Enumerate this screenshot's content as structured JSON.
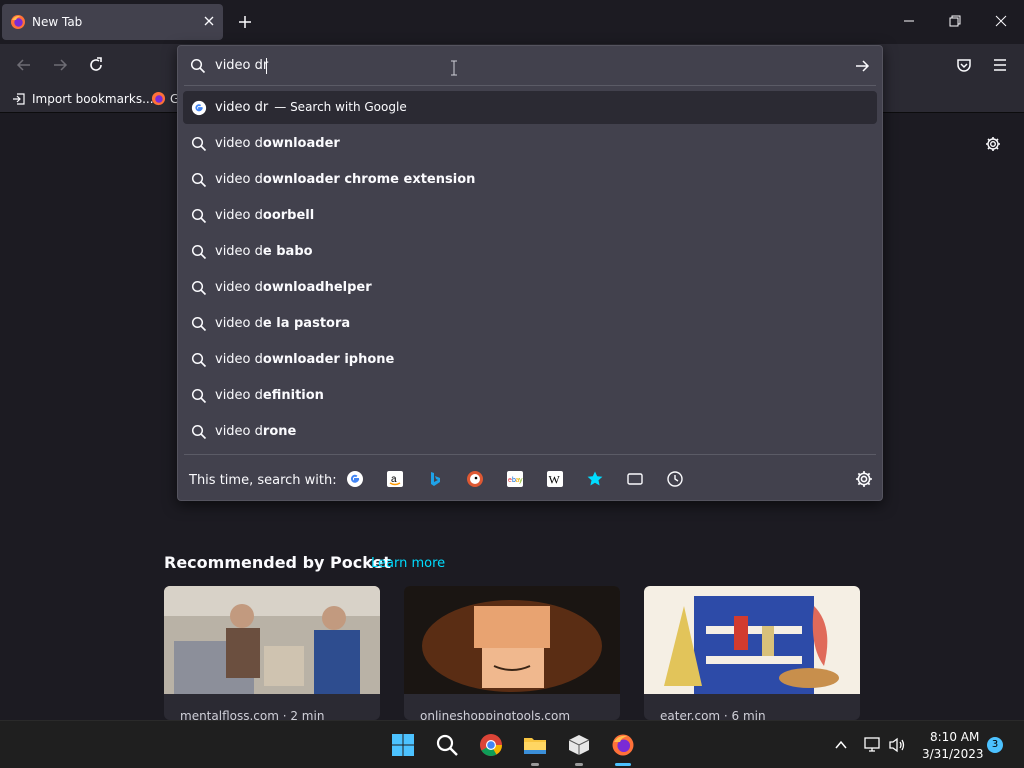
{
  "tab": {
    "title": "New Tab"
  },
  "urlbar": {
    "value": "video dr"
  },
  "bookmarks": [
    {
      "label": "Import bookmarks..."
    },
    {
      "label": "G"
    }
  ],
  "suggestions": [
    {
      "prefix": "video dr",
      "bold": "",
      "suffix": "— Search with Google",
      "selected": true,
      "icon": "google-icon"
    },
    {
      "prefix": "video d",
      "bold": "ownloader",
      "suffix": "",
      "selected": false,
      "icon": "search-icon"
    },
    {
      "prefix": "video d",
      "bold": "ownloader chrome extension",
      "suffix": "",
      "selected": false,
      "icon": "search-icon"
    },
    {
      "prefix": "video d",
      "bold": "oorbell",
      "suffix": "",
      "selected": false,
      "icon": "search-icon"
    },
    {
      "prefix": "video d",
      "bold": "e babo",
      "suffix": "",
      "selected": false,
      "icon": "search-icon"
    },
    {
      "prefix": "video d",
      "bold": "ownloadhelper",
      "suffix": "",
      "selected": false,
      "icon": "search-icon"
    },
    {
      "prefix": "video d",
      "bold": "e la pastora",
      "suffix": "",
      "selected": false,
      "icon": "search-icon"
    },
    {
      "prefix": "video d",
      "bold": "ownloader iphone",
      "suffix": "",
      "selected": false,
      "icon": "search-icon"
    },
    {
      "prefix": "video d",
      "bold": "efinition",
      "suffix": "",
      "selected": false,
      "icon": "search-icon"
    },
    {
      "prefix": "video d",
      "bold": "rone",
      "suffix": "",
      "selected": false,
      "icon": "search-icon"
    }
  ],
  "footer": {
    "label": "This time, search with:",
    "engines": [
      "google-icon",
      "amazon-icon",
      "bing-icon",
      "duckduckgo-icon",
      "ebay-icon",
      "wikipedia-icon",
      "bookmarks-star-icon",
      "tabs-icon",
      "history-icon"
    ]
  },
  "pocket": {
    "title": "Recommended by Pocket",
    "learn_more": "Learn more",
    "cards": [
      {
        "source": "mentalfloss.com · 2 min"
      },
      {
        "source": "onlineshoppingtools.com"
      },
      {
        "source": "eater.com · 6 min"
      }
    ]
  },
  "clock": {
    "time": "8:10 AM",
    "date": "3/31/2023"
  },
  "notifications": {
    "count": "3"
  },
  "colors": {
    "accent": "#00ddff",
    "panel": "#42414d",
    "toolbar": "#2b2a33",
    "background": "#1c1b22"
  }
}
